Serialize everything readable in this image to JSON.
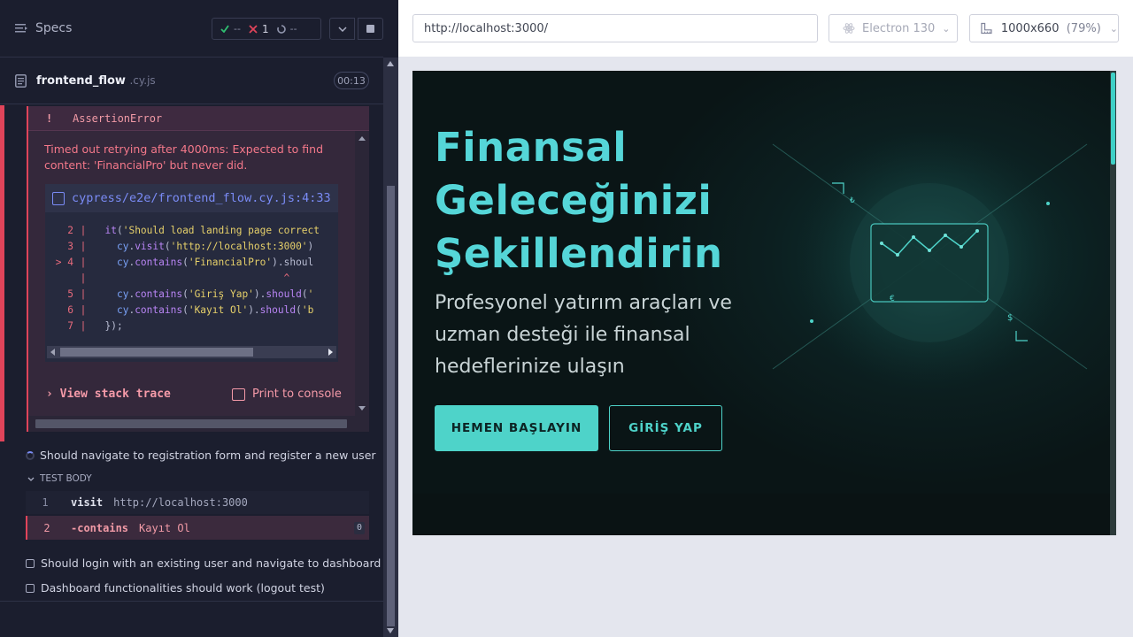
{
  "reporter": {
    "specs_label": "Specs",
    "stats": {
      "passed": "--",
      "failed": "1",
      "pending": "--"
    },
    "spec": {
      "name": "frontend_flow",
      "ext": ".cy.js",
      "duration": "00:13"
    },
    "error": {
      "bang": "!",
      "name": "AssertionError",
      "message": "Timed out retrying after 4000ms: Expected to find content: 'FinancialPro' but never did.",
      "file_link": "cypress/e2e/frontend_flow.cy.js:4:33",
      "view_stack": "View stack trace",
      "print_console": "Print to console"
    },
    "code_lines": [
      {
        "num": "2",
        "marker": "",
        "src": "  it('Should load landing page correct"
      },
      {
        "num": "3",
        "marker": "",
        "src": "    cy.visit('http://localhost:3000')"
      },
      {
        "num": "4",
        "marker": ">",
        "src": "    cy.contains('FinancialPro').shoul"
      },
      {
        "num": "",
        "marker": "",
        "src": "                                ^"
      },
      {
        "num": "5",
        "marker": "",
        "src": "    cy.contains('Giriş Yap').should('"
      },
      {
        "num": "6",
        "marker": "",
        "src": "    cy.contains('Kayıt Ol').should('b"
      },
      {
        "num": "7",
        "marker": "",
        "src": "  });"
      }
    ],
    "running_test": "Should navigate to registration form and register a new user",
    "test_body_label": "TEST BODY",
    "commands": [
      {
        "num": "1",
        "name": "visit",
        "message": "http://localhost:3000"
      },
      {
        "num": "2",
        "name": "-contains",
        "message": "Kayıt Ol",
        "badge": "0"
      }
    ],
    "pending_tests": [
      "Should login with an existing user and navigate to dashboard",
      "Dashboard functionalities should work (logout test)"
    ]
  },
  "aut": {
    "url": "http://localhost:3000/",
    "browser": "Electron 130",
    "viewport": "1000x660",
    "scale": "(79%)",
    "hero_title_lines": [
      "Finansal",
      "Geleceğinizi",
      "Şekillendirin"
    ],
    "hero_subtitle": "Profesyonel yatırım araçları ve uzman desteği ile finansal hedeflerinize ulaşın",
    "cta_primary": "HEMEN BAŞLAYIN",
    "cta_secondary": "GİRİŞ YAP",
    "illustration_symbols": [
      "₺",
      "€",
      "$"
    ]
  },
  "colors": {
    "accent": "#4ed3c9",
    "fail": "#e0445a",
    "link": "#7a8bf5"
  }
}
